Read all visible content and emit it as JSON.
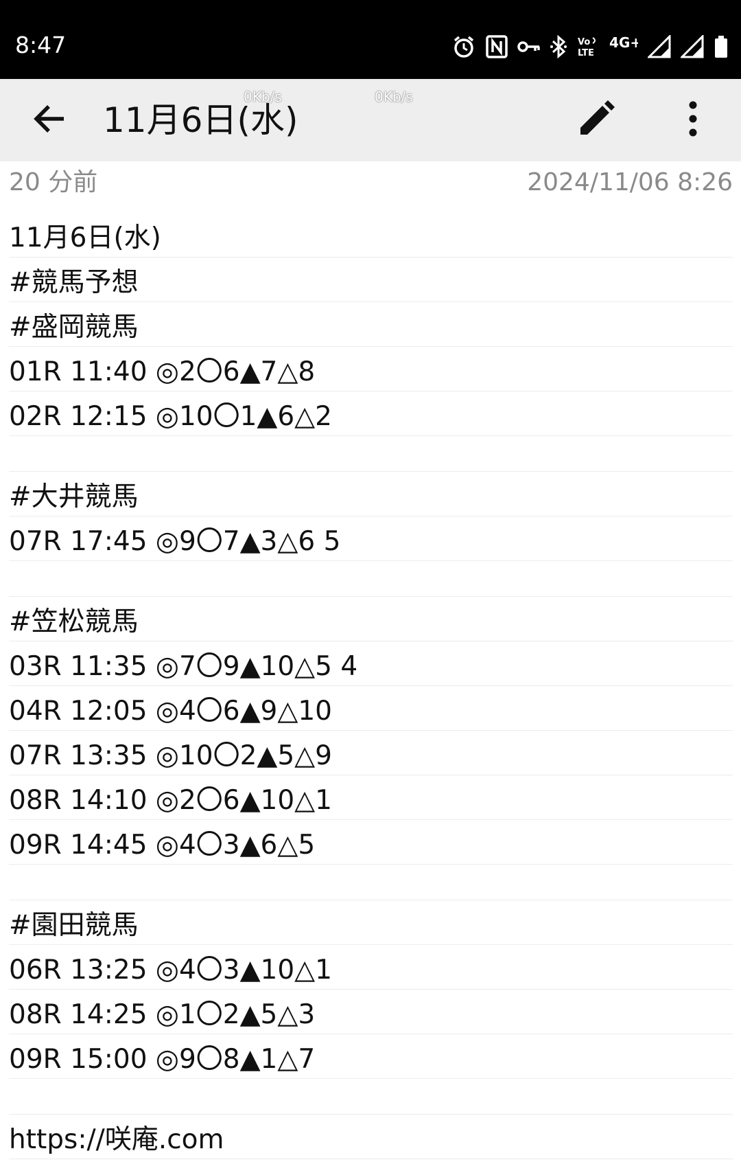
{
  "status_bar": {
    "time": "8:47",
    "icons": [
      "alarm-icon",
      "nfc-icon",
      "vpn-key-icon",
      "bluetooth-icon",
      "volte-icon",
      "4g-plus-icon",
      "signal-icon",
      "signal-icon",
      "battery-icon"
    ],
    "volte_label": "Vo LTE",
    "network_label": "4G+"
  },
  "app_bar": {
    "title": "11月6日(水)",
    "net_speed_1": "0Kb/s",
    "net_speed_2": "0Kb/s",
    "back_icon": "arrow-back-icon",
    "edit_icon": "pencil-icon",
    "more_icon": "more-vert-icon",
    "background": "#eeeeee"
  },
  "meta": {
    "relative_time": "20 分前",
    "timestamp": "2024/11/06 8:26"
  },
  "note": {
    "lines": [
      "11月6日(水)",
      "#競馬予想",
      "#盛岡競馬",
      "01R 11:40 ◎2〇6▲7△8",
      "02R 12:15 ◎10〇1▲6△2",
      "",
      "#大井競馬",
      "07R 17:45 ◎9〇7▲3△6 5",
      "",
      "#笠松競馬",
      "03R 11:35 ◎7〇9▲10△5 4",
      "04R 12:05 ◎4〇6▲9△10",
      "07R 13:35 ◎10〇2▲5△9",
      "08R 14:10 ◎2〇6▲10△1",
      "09R 14:45 ◎4〇3▲6△5",
      "",
      "#園田競馬",
      "06R 13:25 ◎4〇3▲10△1",
      "08R 14:25 ◎1〇2▲5△3",
      "09R 15:00 ◎9〇8▲1△7",
      "",
      "https://咲庵.com"
    ]
  }
}
